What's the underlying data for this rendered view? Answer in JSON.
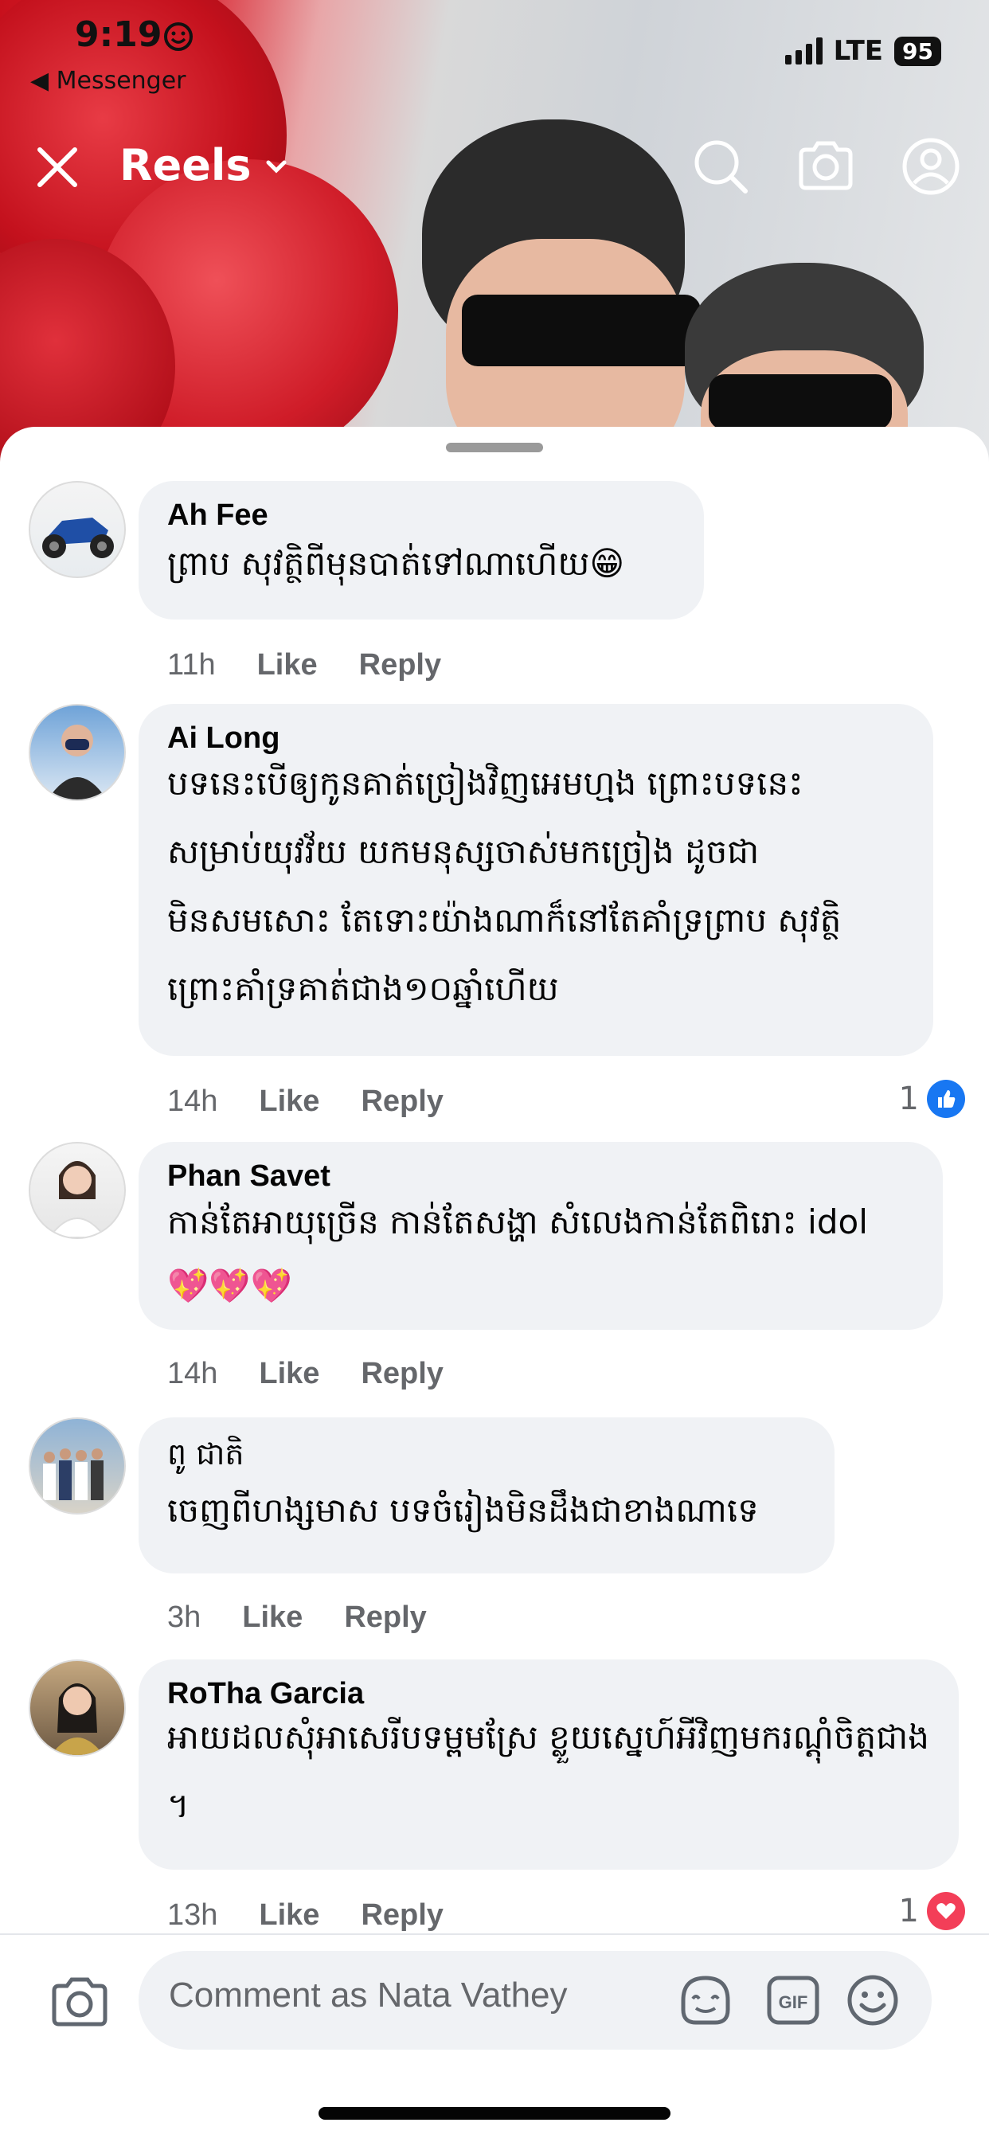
{
  "status_bar": {
    "time": "9:19",
    "back_app": "◀ Messenger",
    "network": "LTE",
    "battery": "95"
  },
  "header": {
    "title": "Reels",
    "icons": [
      "close-icon",
      "chevron-down-icon",
      "search-icon",
      "camera-icon",
      "profile-icon"
    ]
  },
  "comments": [
    {
      "author": "Ah Fee",
      "text": "ព្រាប សុវត្ថិពីមុនបាត់ទៅណាហើយ😁",
      "time": "11h",
      "like_label": "Like",
      "reply_label": "Reply"
    },
    {
      "author": "Ai Long",
      "text": "បទនេះបើឲ្យកូនគាត់ច្រៀងវិញអេមហ្មង ព្រោះបទនេះសម្រាប់យុវវ័យ យកមនុស្សចាស់មកច្រៀង ដូចជាមិនសមសោះ តែទោះយ៉ាងណាក៏នៅតែគាំទ្រព្រាប សុវត្ថិ ព្រោះគាំទ្រគាត់ជាង១០ឆ្នាំហើយ",
      "time": "14h",
      "like_label": "Like",
      "reply_label": "Reply",
      "reaction_count": "1",
      "reaction": "like"
    },
    {
      "author": "Phan Savet",
      "text": "កាន់តែអាយុច្រើន កាន់តែសង្ហា សំលេងកាន់តែពិរោះ idol 💖💖💖",
      "time": "14h",
      "like_label": "Like",
      "reply_label": "Reply"
    },
    {
      "author": "ពូ ជាតិ",
      "text": "ចេញពីហង្សមាស បទចំរៀងមិនដឹងជាខាងណាទេ",
      "time": "3h",
      "like_label": "Like",
      "reply_label": "Reply"
    },
    {
      "author": "RoTha Garcia",
      "text": "អាយដលសុំអាសេរីបទម្ពមស្រែ ខ្លួយស្នេហ៍អីវិញមករណ្ដុំចិត្តជាង ។",
      "time": "13h",
      "like_label": "Like",
      "reply_label": "Reply",
      "reaction_count": "1",
      "reaction": "love"
    }
  ],
  "composer": {
    "placeholder": "Comment as Nata Vathey",
    "icons": [
      "camera-icon",
      "avatar-sticker-icon",
      "gif-icon",
      "emoji-icon"
    ],
    "gif_label": "GIF"
  },
  "colors": {
    "like_blue": "#1877f2",
    "love_red": "#f33e58",
    "bubble_bg": "#f0f2f5",
    "meta_gray": "#65676b"
  }
}
